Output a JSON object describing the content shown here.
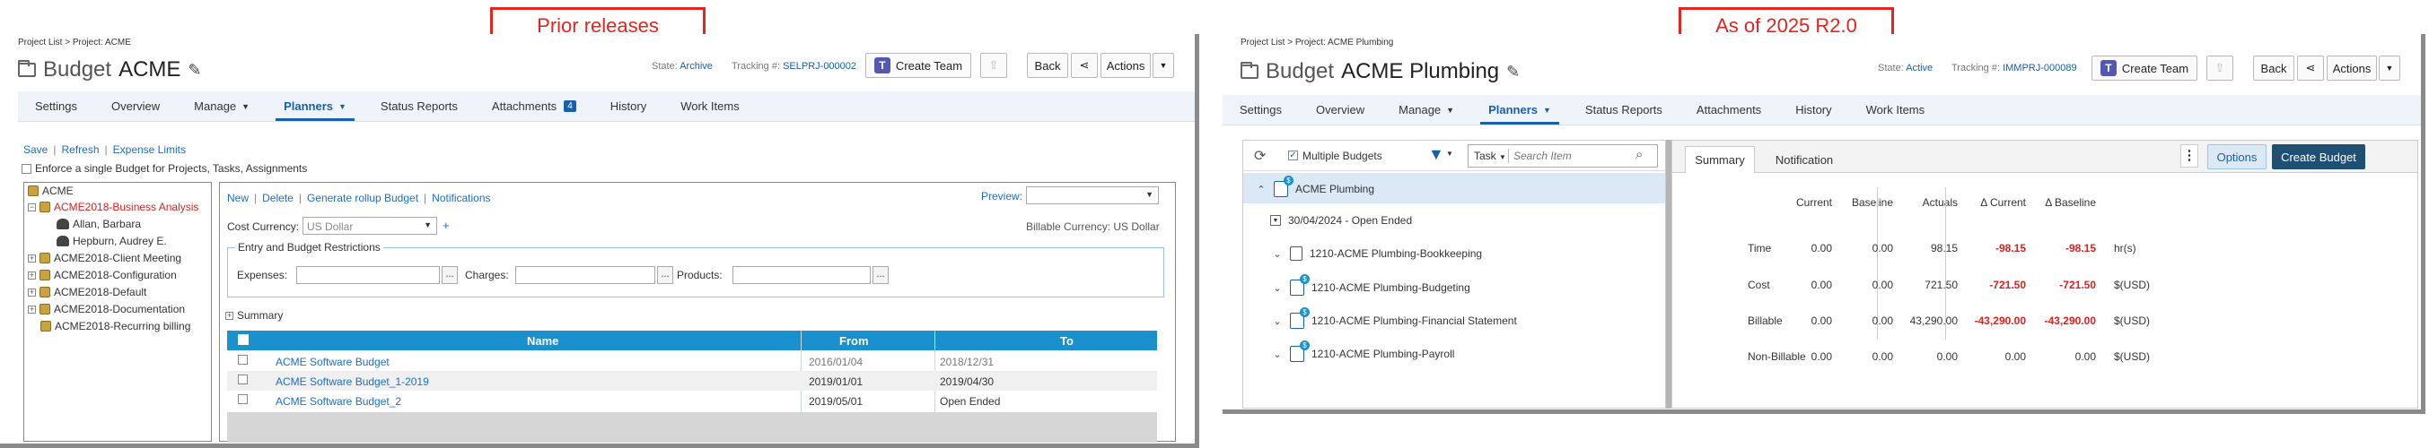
{
  "callouts": {
    "left": "Prior releases",
    "right": "As of 2025 R2.0"
  },
  "left": {
    "breadcrumb": "Project List > Project: ACME",
    "title_prefix": "Budget",
    "title_name": "ACME",
    "state_label": "State:",
    "state_value": "Archive",
    "tracking_label": "Tracking #:",
    "tracking_value": "SELPRJ-000002",
    "buttons": {
      "create_team": "Create Team",
      "back": "Back",
      "actions": "Actions"
    },
    "nav": [
      "Settings",
      "Overview",
      "Manage",
      "Planners",
      "Status Reports",
      "Attachments",
      "History",
      "Work Items"
    ],
    "attachments_count": "4",
    "links": {
      "save": "Save",
      "refresh": "Refresh",
      "expense_limits": "Expense Limits"
    },
    "enforce_label": "Enforce a single Budget for Projects, Tasks, Assignments",
    "tree": {
      "root": "ACME",
      "items": [
        {
          "label": "ACME2018-Business Analysis",
          "color": "#e02020"
        },
        {
          "label": "Allan, Barbara",
          "color": "#222222"
        },
        {
          "label": "Hepburn, Audrey E.",
          "color": "#222222"
        },
        {
          "label": "ACME2018-Client Meeting",
          "color": "#222222"
        },
        {
          "label": "ACME2018-Configuration",
          "color": "#222222"
        },
        {
          "label": "ACME2018-Default",
          "color": "#222222"
        },
        {
          "label": "ACME2018-Documentation",
          "color": "#222222"
        },
        {
          "label": "ACME2018-Recurring billing",
          "color": "#222222"
        }
      ]
    },
    "actions": {
      "new": "New",
      "delete": "Delete",
      "generate": "Generate rollup Budget",
      "notifications": "Notifications",
      "preview": "Preview:"
    },
    "cost_currency_label": "Cost Currency:",
    "cost_currency_value": "US Dollar",
    "billable_currency": "Billable Currency: US Dollar",
    "restrictions_title": "Entry and Budget Restrictions",
    "restrictions": {
      "expenses": "Expenses:",
      "charges": "Charges:",
      "products": "Products:"
    },
    "summary_label": "Summary",
    "table": {
      "headers": [
        "Name",
        "From",
        "To"
      ],
      "rows": [
        {
          "name": "ACME Software Budget",
          "from": "2016/01/04",
          "to": "2018/12/31"
        },
        {
          "name": "ACME Software Budget_1-2019",
          "from": "2019/01/01",
          "to": "2019/04/30"
        },
        {
          "name": "ACME Software Budget_2",
          "from": "2019/05/01",
          "to": "Open Ended"
        }
      ]
    }
  },
  "right": {
    "breadcrumb": "Project List > Project: ACME Plumbing",
    "title_prefix": "Budget",
    "title_name": "ACME Plumbing",
    "state_label": "State:",
    "state_value": "Active",
    "tracking_label": "Tracking #:",
    "tracking_value": "IMMPRJ-000089",
    "buttons": {
      "create_team": "Create Team",
      "back": "Back",
      "actions": "Actions"
    },
    "nav": [
      "Settings",
      "Overview",
      "Manage",
      "Planners",
      "Status Reports",
      "Attachments",
      "History",
      "Work Items"
    ],
    "toolbar": {
      "multiple_budgets": "Multiple Budgets",
      "task": "Task",
      "search_placeholder": "Search Item"
    },
    "tree": {
      "root": "ACME Plumbing",
      "date_row": "30/04/2024 - Open Ended",
      "items": [
        "1210-ACME Plumbing-Bookkeeping",
        "1210-ACME Plumbing-Budgeting",
        "1210-ACME Plumbing-Financial Statement",
        "1210-ACME Plumbing-Payroll"
      ]
    },
    "tabs": {
      "summary": "Summary",
      "notification": "Notification"
    },
    "buttons2": {
      "options": "Options",
      "create_budget": "Create Budget"
    },
    "grid": {
      "headers": [
        "Current",
        "Baseline",
        "Actuals",
        "Δ Current",
        "Δ Baseline"
      ],
      "rows": [
        {
          "label": "Time",
          "values": [
            "0.00",
            "0.00",
            "98.15",
            "-98.15",
            "-98.15"
          ],
          "unit": "hr(s)"
        },
        {
          "label": "Cost",
          "values": [
            "0.00",
            "0.00",
            "721.50",
            "-721.50",
            "-721.50"
          ],
          "unit": "$(USD)"
        },
        {
          "label": "Billable",
          "values": [
            "0.00",
            "0.00",
            "43,290.00",
            "-43,290.00",
            "-43,290.00"
          ],
          "unit": "$(USD)"
        },
        {
          "label": "Non-Billable",
          "values": [
            "0.00",
            "0.00",
            "0.00",
            "0.00",
            "0.00"
          ],
          "unit": "$(USD)"
        }
      ]
    }
  }
}
